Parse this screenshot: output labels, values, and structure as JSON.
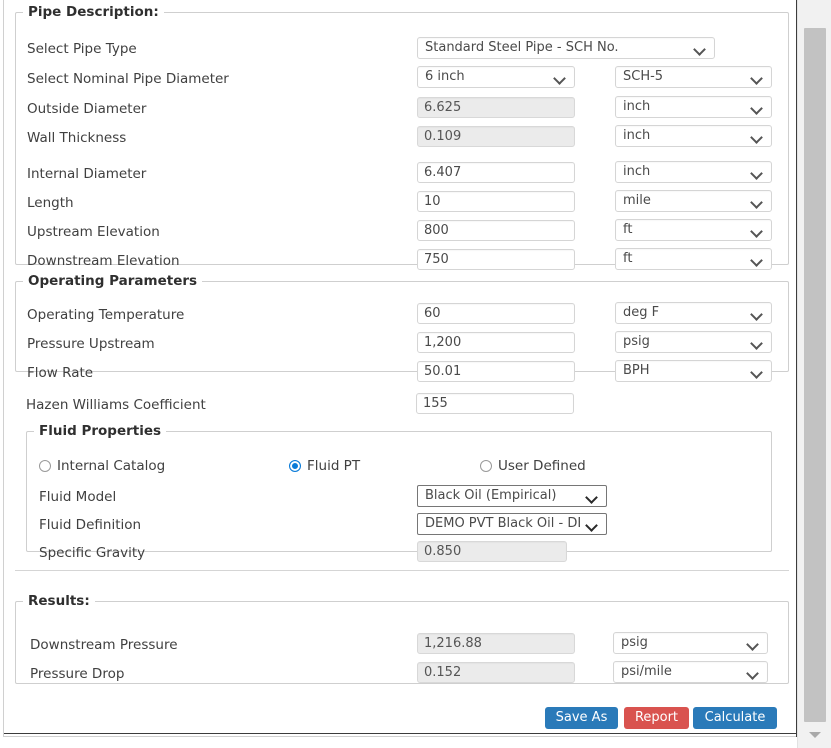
{
  "sections": {
    "pipe_description": {
      "legend": "Pipe Description:",
      "rows": [
        {
          "label": "Select Pipe Type",
          "value": "Standard Steel Pipe - SCH No.",
          "kind": "dropdown-wide"
        },
        {
          "label": "Select Nominal Pipe Diameter",
          "value": "6 inch",
          "unit": "SCH-5",
          "kind": "dropdown-pair"
        },
        {
          "label": "Outside Diameter",
          "value": "6.625",
          "unit": "inch",
          "kind": "readonly"
        },
        {
          "label": "Wall Thickness",
          "value": "0.109",
          "unit": "inch",
          "kind": "readonly"
        },
        {
          "label": "Internal Diameter",
          "value": "6.407",
          "unit": "inch",
          "kind": "input"
        },
        {
          "label": "Length",
          "value": "10",
          "unit": "mile",
          "kind": "input"
        },
        {
          "label": "Upstream Elevation",
          "value": "800",
          "unit": "ft",
          "kind": "input"
        },
        {
          "label": "Downstream Elevation",
          "value": "750",
          "unit": "ft",
          "kind": "input"
        }
      ]
    },
    "operating_parameters": {
      "legend": "Operating Parameters",
      "rows": [
        {
          "label": "Operating Temperature",
          "value": "60",
          "unit": "deg F"
        },
        {
          "label": "Pressure Upstream",
          "value": "1,200",
          "unit": "psig"
        },
        {
          "label": "Flow Rate",
          "value": "50.01",
          "unit": "BPH"
        }
      ]
    },
    "hazen": {
      "label": "Hazen Williams Coefficient",
      "value": "155"
    },
    "fluid_properties": {
      "legend": "Fluid Properties",
      "radios": [
        {
          "label": "Internal Catalog",
          "selected": false
        },
        {
          "label": "Fluid PT",
          "selected": true
        },
        {
          "label": "User Defined",
          "selected": false
        }
      ],
      "rows": [
        {
          "label": "Fluid Model",
          "value": "Black Oil (Empirical)",
          "kind": "native"
        },
        {
          "label": "Fluid Definition",
          "value": "DEMO PVT Black Oil - DEM",
          "kind": "native"
        },
        {
          "label": "Specific Gravity",
          "value": "0.850",
          "kind": "readonly"
        }
      ]
    },
    "results": {
      "legend": "Results:",
      "rows": [
        {
          "label": "Downstream Pressure",
          "value": "1,216.88",
          "unit": "psig"
        },
        {
          "label": "Pressure Drop",
          "value": "0.152",
          "unit": "psi/mile"
        }
      ]
    }
  },
  "buttons": [
    {
      "label": "Save As",
      "color": "#2a7ab9"
    },
    {
      "label": "Report",
      "color": "#d9534f"
    },
    {
      "label": "Calculate",
      "color": "#2a7ab9"
    }
  ],
  "scrollbar": {
    "down_arrow_icon": "chevron-down-icon"
  },
  "colors": {
    "primary_blue": "#2a7ab9",
    "danger_red": "#d9534f",
    "radio_selected": "#0a7bd8",
    "readonly_bg": "#ebebeb",
    "border": "#cfcfcf"
  }
}
